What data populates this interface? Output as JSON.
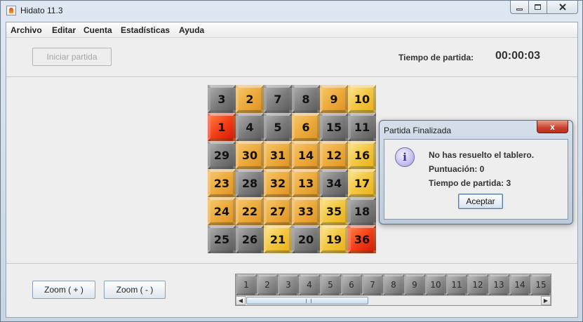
{
  "window": {
    "title": "Hidato 11.3"
  },
  "menu": [
    "Archivo",
    "Editar",
    "Cuenta",
    "Estadísticas",
    "Ayuda"
  ],
  "toolbar": {
    "start_label": "Iniciar partida",
    "time_label": "Tiempo de partida:",
    "time_value": "00:00:03"
  },
  "board": {
    "rows": [
      [
        {
          "v": "3",
          "c": "gray"
        },
        {
          "v": "2",
          "c": "orange"
        },
        {
          "v": "7",
          "c": "gray"
        },
        {
          "v": "8",
          "c": "gray"
        },
        {
          "v": "9",
          "c": "orange"
        },
        {
          "v": "10",
          "c": "yellow"
        }
      ],
      [
        {
          "v": "1",
          "c": "red"
        },
        {
          "v": "4",
          "c": "gray"
        },
        {
          "v": "5",
          "c": "gray"
        },
        {
          "v": "6",
          "c": "orange"
        },
        {
          "v": "15",
          "c": "gray"
        },
        {
          "v": "11",
          "c": "gray"
        }
      ],
      [
        {
          "v": "29",
          "c": "gray"
        },
        {
          "v": "30",
          "c": "orange"
        },
        {
          "v": "31",
          "c": "orange"
        },
        {
          "v": "14",
          "c": "orange"
        },
        {
          "v": "12",
          "c": "orange"
        },
        {
          "v": "16",
          "c": "yellow"
        }
      ],
      [
        {
          "v": "23",
          "c": "orange"
        },
        {
          "v": "28",
          "c": "gray"
        },
        {
          "v": "32",
          "c": "orange"
        },
        {
          "v": "13",
          "c": "orange"
        },
        {
          "v": "34",
          "c": "gray"
        },
        {
          "v": "17",
          "c": "yellow"
        }
      ],
      [
        {
          "v": "24",
          "c": "orange"
        },
        {
          "v": "22",
          "c": "orange"
        },
        {
          "v": "27",
          "c": "orange"
        },
        {
          "v": "33",
          "c": "orange"
        },
        {
          "v": "35",
          "c": "yellow"
        },
        {
          "v": "18",
          "c": "gray"
        }
      ],
      [
        {
          "v": "25",
          "c": "gray"
        },
        {
          "v": "26",
          "c": "gray"
        },
        {
          "v": "21",
          "c": "yellow"
        },
        {
          "v": "20",
          "c": "gray"
        },
        {
          "v": "19",
          "c": "yellow"
        },
        {
          "v": "36",
          "c": "red"
        }
      ]
    ]
  },
  "zoom": {
    "in_label": "Zoom ( + )",
    "out_label": "Zoom ( - )"
  },
  "palette": {
    "numbers": [
      "1",
      "2",
      "3",
      "4",
      "5",
      "6",
      "7",
      "8",
      "9",
      "10",
      "11",
      "12",
      "13",
      "14",
      "15"
    ]
  },
  "dialog": {
    "title": "Partida Finalizada",
    "close_label": "x",
    "icon_glyph": "i",
    "message": "No has resuelto el tablero.",
    "score": "Puntuación: 0",
    "time": "Tiempo de partida: 3",
    "ok_label": "Aceptar"
  },
  "colors": {
    "gray": "#7a7a7a",
    "orange": "#ecab3a",
    "yellow": "#f3c63d",
    "red": "#f23a14"
  }
}
